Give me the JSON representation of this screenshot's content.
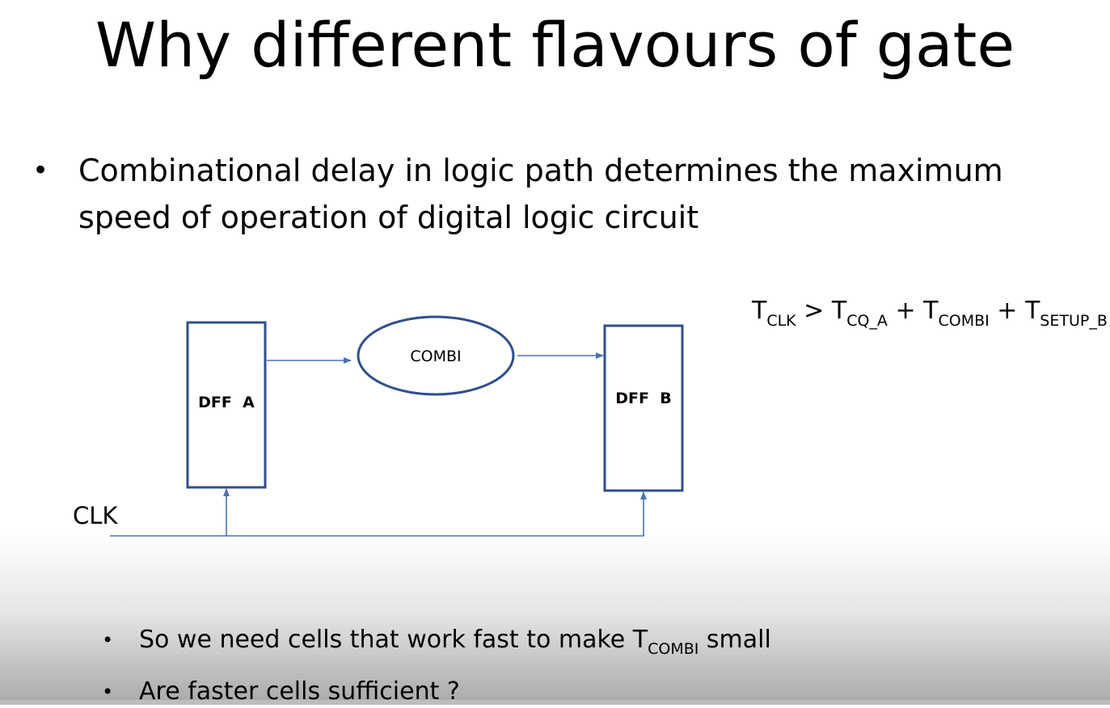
{
  "slide": {
    "title": "Why different flavours of gate",
    "bullet_main": "Combinational delay in logic path determines the maximum speed of operation of digital logic circuit",
    "bullet_symbol": "•"
  },
  "diagram": {
    "dff_a_label": "DFF  A",
    "combi_label": "COMBI",
    "dff_b_label": "DFF  B",
    "clk_label": "CLK",
    "line_color": "#4a72b8",
    "box_color": "#2f4f8f"
  },
  "formula": {
    "t1": "T",
    "s1": "CLK",
    "op1": " > ",
    "t2": "T",
    "s2": "CQ_A",
    "op2": " + ",
    "t3": "T",
    "s3": "COMBI",
    "op3": " + ",
    "t4": "T",
    "s4": "SETUP_B"
  },
  "lower_bullets": {
    "b1_pre": "So we need cells that work fast to make T",
    "b1_sub": "COMBI",
    "b1_post": " small",
    "b2": "Are faster cells sufficient ?"
  }
}
